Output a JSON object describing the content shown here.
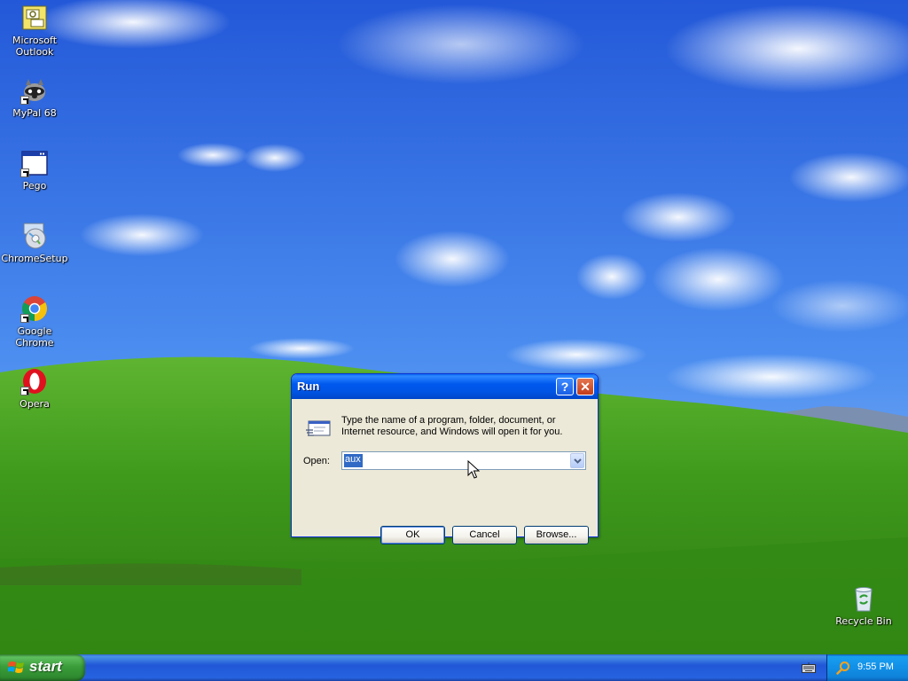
{
  "desktop": {
    "icons": [
      {
        "label": "Microsoft\nOutlook",
        "icon": "outlook-icon"
      },
      {
        "label": "MyPal 68",
        "icon": "mypal-icon"
      },
      {
        "label": "Pego",
        "icon": "pego-icon"
      },
      {
        "label": "ChromeSetup",
        "icon": "chromesetup-icon"
      },
      {
        "label": "Google Chrome",
        "icon": "chrome-icon"
      },
      {
        "label": "Opera",
        "icon": "opera-icon"
      },
      {
        "label": "Recycle Bin",
        "icon": "recycle-bin-icon"
      }
    ]
  },
  "run_dialog": {
    "title": "Run",
    "help_glyph": "?",
    "close_glyph": "✕",
    "description": "Type the name of a program, folder, document, or Internet resource, and Windows will open it for you.",
    "open_label": "Open:",
    "open_value": "aux",
    "ok_label": "OK",
    "cancel_label": "Cancel",
    "browse_label": "Browse..."
  },
  "taskbar": {
    "start_label": "start",
    "clock": "9:55 PM"
  },
  "colors": {
    "sky": "#2a64e0",
    "grass": "#3f9a1c",
    "titlebar": "#0055e5",
    "start_green": "#3a9d3a",
    "taskbar_blue": "#2157d7"
  }
}
